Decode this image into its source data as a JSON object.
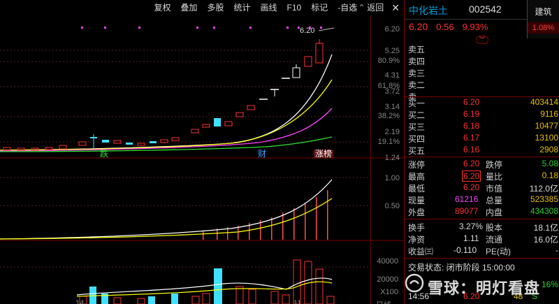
{
  "toolbar": {
    "items": [
      "复权",
      "叠加",
      "多股",
      "统计",
      "画线",
      "F10",
      "标记",
      "-自选",
      "返回"
    ],
    "close": "✕"
  },
  "chart": {
    "price_axis": [
      "6.20",
      "5.25",
      "80.9%",
      "4.31",
      "61.8%",
      "3.72",
      "3.14",
      "38.2%",
      "2.19",
      "19.1%",
      "1.24"
    ],
    "high_label": "6.20",
    "event_labels": {
      "die": "跌",
      "cai": "财",
      "zhangbang": "涨榜"
    },
    "vol_axis": [
      "1.00",
      "0.50"
    ],
    "vol2_axis": [
      "40000",
      "20000",
      "X100"
    ],
    "bottom_labels": [
      "14",
      "11",
      "日线"
    ],
    "colors": {
      "up": "#ff3030",
      "down": "#40e0ff",
      "ma5": "#ffffff",
      "ma10": "#ffff00",
      "ma20": "#ff40ff",
      "ma60": "#30e030"
    }
  },
  "chart_data": {
    "type": "candlestick",
    "candles_up_height_order": [
      1,
      2,
      3,
      4,
      5,
      6,
      7,
      8
    ],
    "last_close": 6.2,
    "price_range": [
      1.24,
      6.2
    ]
  },
  "stock": {
    "name": "中化岩土",
    "code": "002542",
    "price": "6.20",
    "change": "0.56",
    "pct": "9.93%",
    "industry": "建筑",
    "industry_pct": "1.08%"
  },
  "asks": [
    {
      "label": "卖五",
      "price": "",
      "vol": ""
    },
    {
      "label": "卖四",
      "price": "",
      "vol": ""
    },
    {
      "label": "卖三",
      "price": "",
      "vol": ""
    },
    {
      "label": "卖二",
      "price": "",
      "vol": ""
    },
    {
      "label": "卖一",
      "price": "",
      "vol": ""
    }
  ],
  "bids": [
    {
      "label": "买一",
      "price": "6.20",
      "vol": "403414"
    },
    {
      "label": "买二",
      "price": "6.19",
      "vol": "9116"
    },
    {
      "label": "买三",
      "price": "6.18",
      "vol": "10477"
    },
    {
      "label": "买四",
      "price": "6.17",
      "vol": "13100"
    },
    {
      "label": "买五",
      "price": "6.16",
      "vol": "2908"
    }
  ],
  "stats": {
    "zhangting_l": "涨停",
    "zhangting_v": "6.20",
    "dieting_l": "跌停",
    "dieting_v": "5.08",
    "zuigao_l": "最高",
    "zuigao_v": "6.20",
    "liangbi_l": "量比",
    "liangbi_v": "0.18",
    "zuidi_l": "最低",
    "zuidi_v": "6.20",
    "shizhi_l": "市值",
    "shizhi_v": "112.0亿",
    "xianliang_l": "现量",
    "xianliang_v": "61216",
    "zongliang_l": "总量",
    "zongliang_v": "523385",
    "waipan_l": "外盘",
    "waipan_v": "89077",
    "neipan_l": "内盘",
    "neipan_v": "434308",
    "huanshou_l": "换手",
    "huanshou_v": "3.27%",
    "guben_l": "股本",
    "guben_v": "18.1亿",
    "jingzi_l": "净资",
    "jingzi_v": "1.11",
    "liutong_l": "流通",
    "liutong_v": "16.0亿",
    "shouyi_l": "收益㈢",
    "shouyi_v": "-0.110",
    "pe_l": "PE(动)",
    "pe_v": "-",
    "status": "交易状态: 闭市阶段 15:00:00",
    "last_time": "14:56",
    "last_price": "6.20",
    "last_vol": "48",
    "last_side": "S",
    "pct_partial": "16%"
  },
  "watermark": "雪球：明灯看盘"
}
